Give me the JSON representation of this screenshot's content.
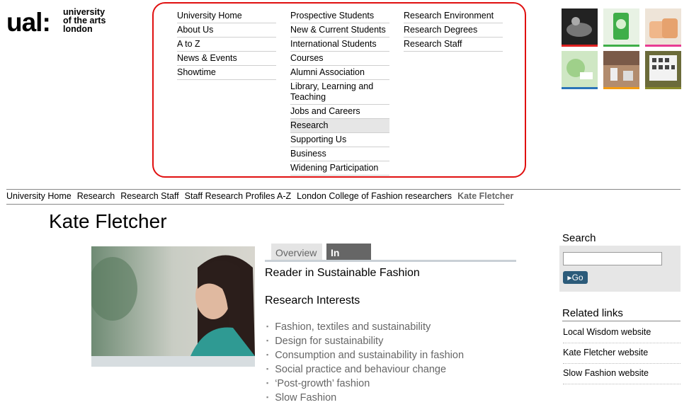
{
  "logo": {
    "mark": "ual:",
    "line1": "university",
    "line2": "of the arts",
    "line3": "london"
  },
  "menu": {
    "col1": [
      "University Home",
      "About Us",
      "A to Z",
      "News & Events",
      "Showtime"
    ],
    "col2": [
      "Prospective Students",
      "New & Current Students",
      "International Students",
      "Courses",
      "Alumni Association",
      "Library, Learning and Teaching",
      "Jobs and Careers",
      "Research",
      "Supporting Us",
      "Business",
      "Widening Participation"
    ],
    "col3": [
      "Research Environment",
      "Research Degrees",
      "Research Staff"
    ],
    "active": "Research"
  },
  "thumb_colors": [
    "#e02020",
    "#3fae49",
    "#e83c93",
    "#2a74b8",
    "#f39c12",
    "#8a8a2a"
  ],
  "breadcrumb": [
    "University Home",
    "Research",
    "Research Staff",
    "Staff Research Profiles A-Z",
    "London College of Fashion researchers"
  ],
  "breadcrumb_current": "Kate Fletcher",
  "page_title": "Kate Fletcher",
  "tabs": {
    "overview": "Overview",
    "detail": "In Detail"
  },
  "role": "Reader in Sustainable Fashion",
  "interests_heading": "Research Interests",
  "interests": [
    "Fashion, textiles and sustainability",
    "Design for sustainability",
    "Consumption and sustainability in fashion",
    "Social practice and behaviour change",
    "‘Post-growth’ fashion",
    "Slow Fashion"
  ],
  "search": {
    "heading": "Search",
    "button": "Go",
    "value": ""
  },
  "related": {
    "heading": "Related links",
    "links": [
      "Local Wisdom website",
      "Kate Fletcher website",
      "Slow Fashion website"
    ]
  }
}
